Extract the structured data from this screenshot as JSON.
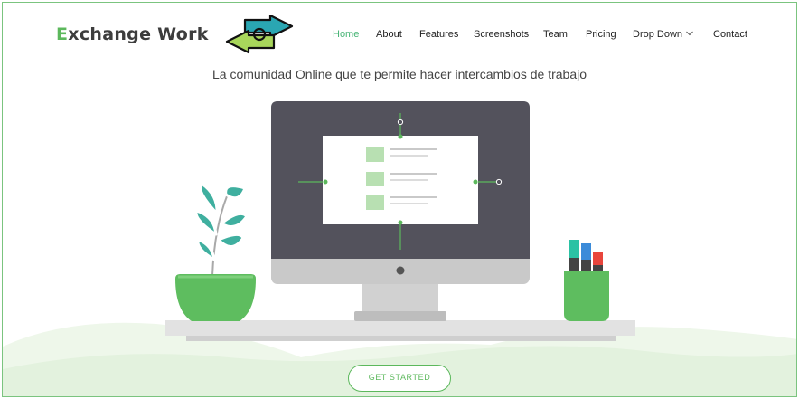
{
  "brand": {
    "first_letter": "E",
    "rest": "xchange Work",
    "accent": "#5cb85c"
  },
  "nav": {
    "items": [
      {
        "label": "Home",
        "active": true
      },
      {
        "label": "About"
      },
      {
        "label": "Features"
      },
      {
        "label": "Screenshots"
      },
      {
        "label": "Team"
      },
      {
        "label": "Pricing"
      },
      {
        "label": "Drop Down",
        "dropdown": true
      },
      {
        "label": "Contact"
      }
    ]
  },
  "hero": {
    "tagline": "La comunidad Online que te permite hacer intercambios de trabajo",
    "cta_label": "GET STARTED"
  },
  "colors": {
    "accent": "#5cb85c",
    "nav_active": "#47b475",
    "monitor_screen": "#53525c",
    "frame_border": "#7bc47f"
  },
  "icons": [
    "exchange-arrows-icon",
    "chevron-down-icon"
  ]
}
